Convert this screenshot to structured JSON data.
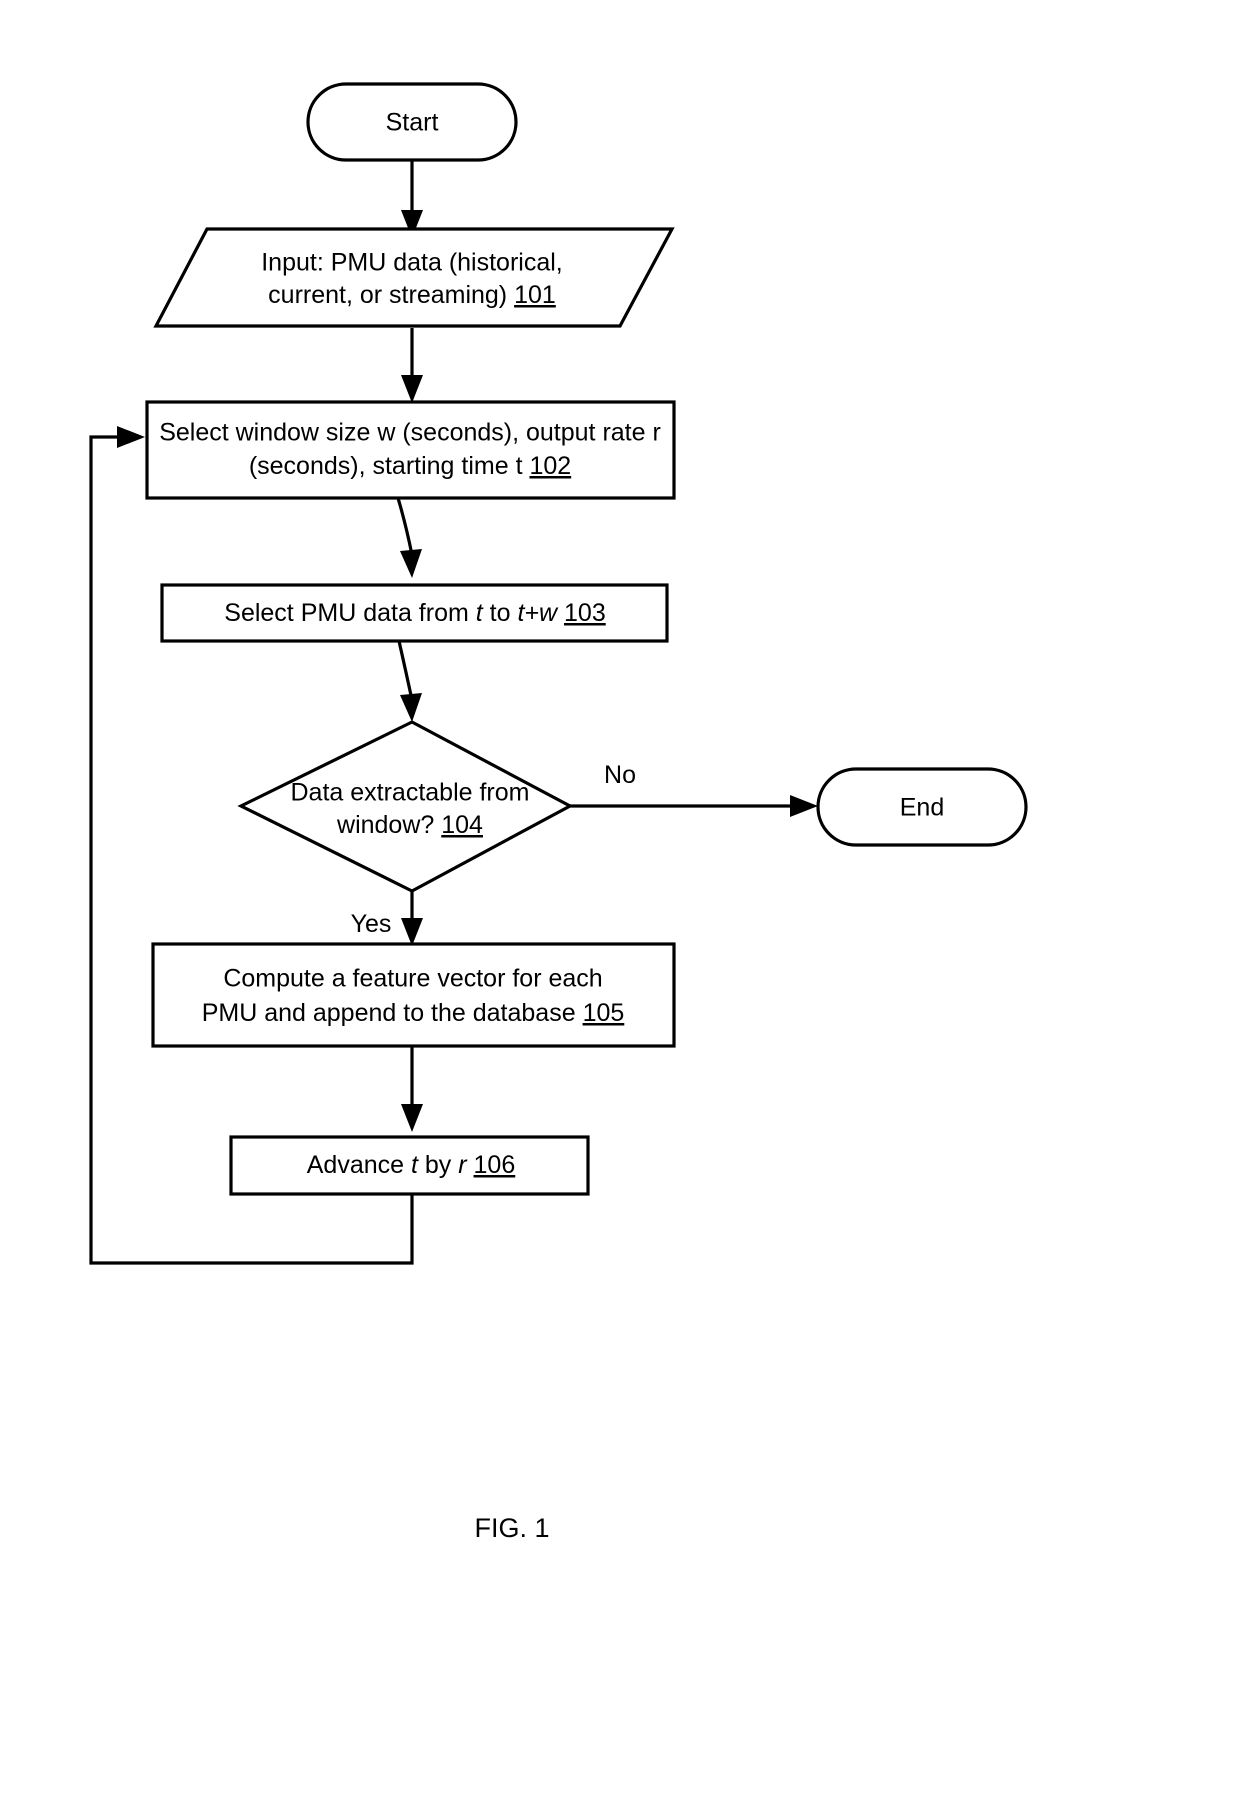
{
  "figure": {
    "caption": "FIG. 1",
    "type": "flowchart"
  },
  "nodes": {
    "start": {
      "shape": "terminator",
      "label": "Start"
    },
    "input": {
      "shape": "parallelogram",
      "line1": "Input: PMU data (historical,",
      "line2_a": "current, or streaming) ",
      "line2_ref": "101"
    },
    "select_window": {
      "shape": "process",
      "line1": "Select window size w (seconds), output rate r",
      "line2_a": "(seconds), starting time t ",
      "line2_ref": "102"
    },
    "select_data": {
      "shape": "process",
      "seg1": "Select PMU data from ",
      "seg2_ital": "t",
      "seg3": " to ",
      "seg4_ital": "t+w",
      "seg5": " ",
      "ref": "103"
    },
    "decision": {
      "shape": "diamond",
      "line1": "Data extractable from",
      "line2_a": "window? ",
      "line2_ref": "104"
    },
    "end": {
      "shape": "terminator",
      "label": "End"
    },
    "compute": {
      "shape": "process",
      "line1": "Compute a feature vector for each",
      "line2_a": "PMU and append to the database ",
      "line2_ref": "105"
    },
    "advance": {
      "shape": "process",
      "seg1": "Advance ",
      "seg2_ital": "t",
      "seg3": " by ",
      "seg4_ital": "r",
      "seg5": " ",
      "ref": "106"
    }
  },
  "edge_labels": {
    "no": "No",
    "yes": "Yes"
  },
  "colors": {
    "stroke": "#000000",
    "fill": "#ffffff",
    "text": "#000000"
  }
}
